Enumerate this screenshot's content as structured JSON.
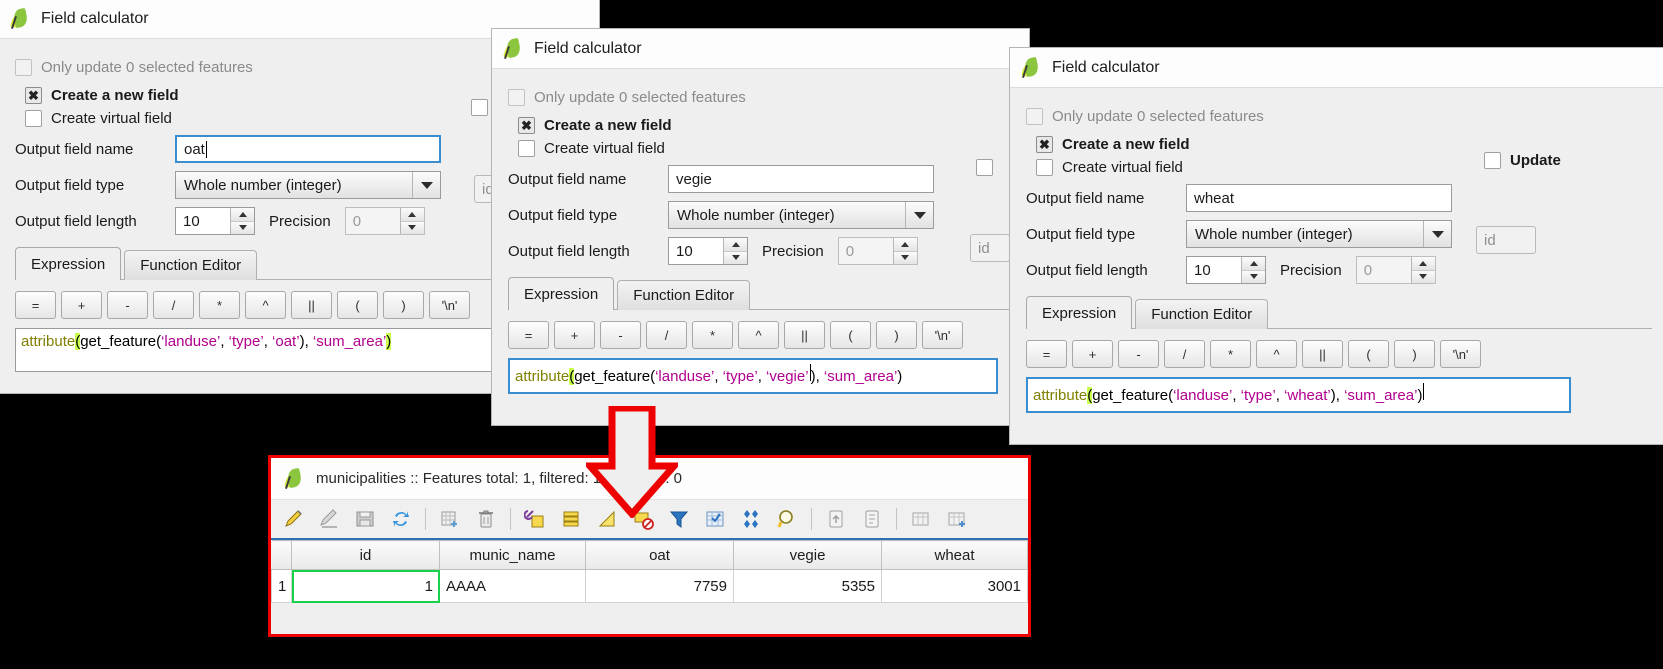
{
  "app": {
    "title": "Field calculator",
    "logo_icon": "qgis-leaf-icon"
  },
  "common": {
    "only_update_label": "Only update 0 selected features",
    "create_new_field_label": "Create a new field",
    "create_virtual_field_label": "Create virtual field",
    "output_field_name_label": "Output field name",
    "output_field_type_label": "Output field type",
    "output_field_length_label": "Output field length",
    "precision_label": "Precision",
    "field_type_value": "Whole number (integer)",
    "field_length_value": "10",
    "precision_value": "0",
    "tab_expression": "Expression",
    "tab_function_editor": "Function Editor",
    "operator_buttons": [
      "=",
      "+",
      "-",
      "/",
      "*",
      "^",
      "||",
      "(",
      ")",
      "'\\n'"
    ],
    "update_existing_field_label": "Update",
    "existing_field_value": "id",
    "checked_glyph": "✖"
  },
  "dialogs": [
    {
      "id": "oat",
      "field_name": "oat",
      "field_name_focused": true,
      "expression": {
        "fn": "attribute",
        "open_paren": "(",
        "mid": "get_feature(",
        "arg1": "‘landuse’",
        "sep1": ", ",
        "arg2": "‘type’",
        "sep2": ", ",
        "arg3": "‘oat’",
        "close_inner": ")",
        "sep3": ", ",
        "arg4": "‘sum_area’",
        "close_paren": ")"
      }
    },
    {
      "id": "vegie",
      "field_name": "vegie",
      "field_name_focused": false,
      "expression": {
        "fn": "attribute",
        "open_paren": "(",
        "mid": "get_feature(",
        "arg1": "‘landuse’",
        "sep1": ", ",
        "arg2": "‘type’",
        "sep2": ", ",
        "arg3": "‘vegie’",
        "close_inner": ")",
        "sep3": ", ",
        "arg4": "‘sum_area’",
        "close_paren": ")"
      }
    },
    {
      "id": "wheat",
      "field_name": "wheat",
      "field_name_focused": false,
      "expression": {
        "fn": "attribute",
        "open_paren": "(",
        "mid": "get_feature(",
        "arg1": "‘landuse’",
        "sep1": ", ",
        "arg2": "‘type’",
        "sep2": ", ",
        "arg3": "‘wheat’",
        "close_inner": ")",
        "sep3": ", ",
        "arg4": "‘sum_area’",
        "close_paren": ")"
      }
    }
  ],
  "attribute_table": {
    "title": "municipalities :: Features total: 1, filtered: 1, selected: 0",
    "toolbar_icons": [
      "toggle-editing-pencil-icon",
      "save-edits-icon",
      "save-layer-edits-icon",
      "reload-table-icon",
      "add-feature-icon",
      "delete-selected-icon",
      "cut-features-icon",
      "copy-features-icon",
      "paste-features-icon",
      "delete-field-icon",
      "select-by-expression-filter-icon",
      "select-all-icon",
      "invert-selection-icon",
      "zoom-to-selection-icon",
      "pan-to-selection-icon",
      "move-selection-to-top-icon",
      "new-field-icon",
      "delete-field-column-icon",
      "organize-columns-icon"
    ],
    "columns": [
      "id",
      "munic_name",
      "oat",
      "vegie",
      "wheat"
    ],
    "rows": [
      {
        "row_number": "1",
        "id": "1",
        "munic_name": "AAAA",
        "oat": "7759",
        "vegie": "5355",
        "wheat": "3001"
      }
    ]
  },
  "annotation": {
    "arrow_icon": "red-down-arrow",
    "arrow_color": "#ee0000"
  }
}
